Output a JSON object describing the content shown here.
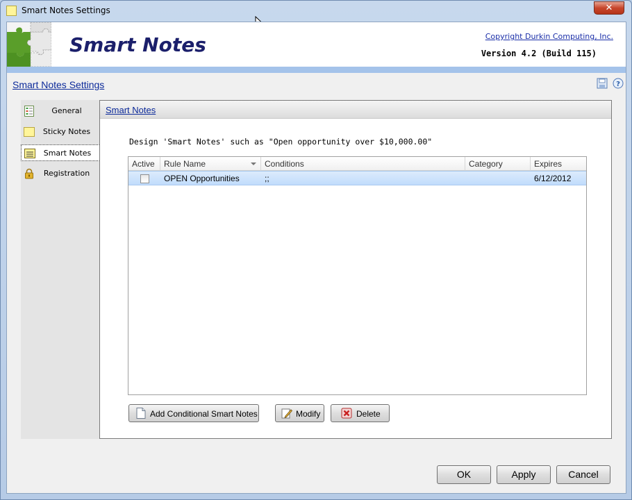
{
  "window": {
    "title": "Smart Notes Settings",
    "close_label": "✕"
  },
  "header": {
    "app_title": "Smart Notes",
    "copyright": "Copyright Durkin Computing, Inc.",
    "version": "Version 4.2 (Build 115)"
  },
  "settings_bar": {
    "title": "Smart Notes Settings",
    "save_icon": "save-icon",
    "help_icon": "help-icon"
  },
  "sidebar": {
    "items": [
      {
        "label": "General",
        "icon": "checklist-icon",
        "selected": false
      },
      {
        "label": "Sticky Notes",
        "icon": "sticky-note-icon",
        "selected": false
      },
      {
        "label": "Smart Notes",
        "icon": "smart-note-icon",
        "selected": true
      },
      {
        "label": "Registration",
        "icon": "lock-icon",
        "selected": false
      }
    ]
  },
  "panel": {
    "title": "Smart Notes",
    "description": "Design 'Smart Notes' such as \"Open opportunity over $10,000.00\"",
    "columns": [
      "Active",
      "Rule Name",
      "Conditions",
      "Category",
      "Expires"
    ],
    "rows": [
      {
        "active": false,
        "rule_name": "OPEN Opportunities",
        "conditions": ";;",
        "category": "",
        "expires": "6/12/2012"
      }
    ],
    "buttons": {
      "add": "Add Conditional Smart Notes",
      "modify": "Modify",
      "delete": "Delete"
    }
  },
  "footer": {
    "ok": "OK",
    "apply": "Apply",
    "cancel": "Cancel"
  },
  "colors": {
    "title_text": "#1b1f6b",
    "link": "#0c2a9a",
    "selected_row": "#c1dcfc",
    "header_band": "#a4c3ea"
  }
}
